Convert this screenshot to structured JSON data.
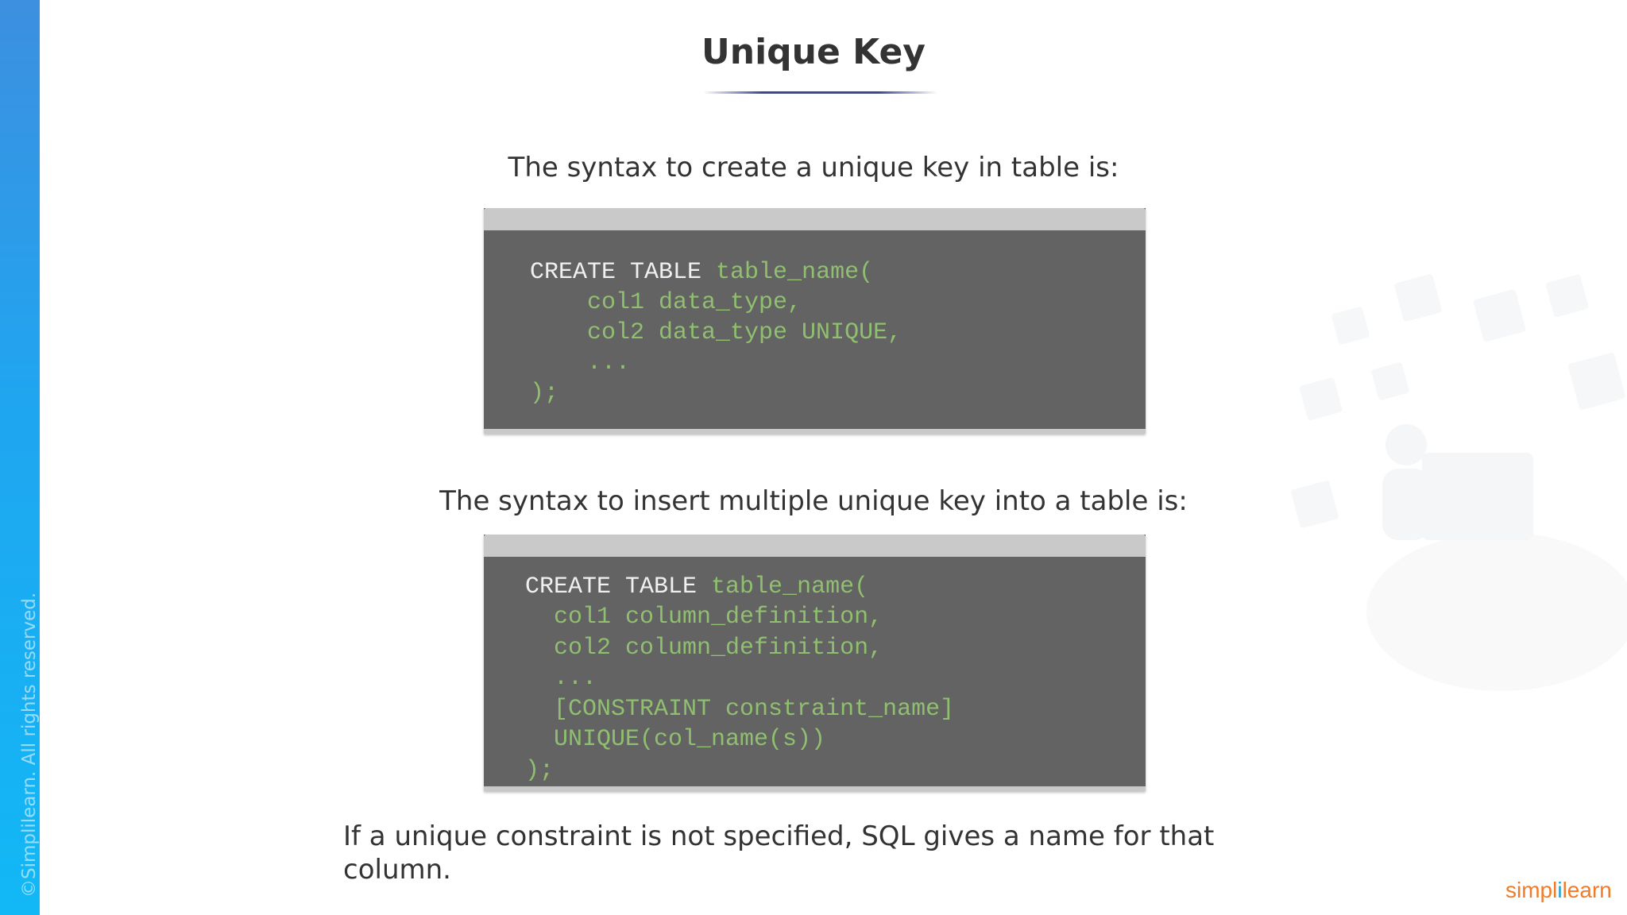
{
  "slide": {
    "title": "Unique Key",
    "copyright": "©Simplilearn. All rights reserved.",
    "caption1": "The syntax to create a unique key in table is:",
    "code1": {
      "line1_kw": "CREATE TABLE ",
      "line1_rest": "table_name(",
      "line2": "    col1 data_type,",
      "line3": "    col2 data_type UNIQUE,",
      "line4": "    ...",
      "line5": ");"
    },
    "caption2": "The syntax to insert multiple unique key into a table is:",
    "code2": {
      "line1_kw": "CREATE TABLE ",
      "line1_rest": "table_name(",
      "line2": "  col1 column_definition,",
      "line3": "  col2 column_definition,",
      "line4": "  ...",
      "line5": "  [CONSTRAINT constraint_name]",
      "line6": "  UNIQUE(col_name(s))",
      "line7": ");"
    },
    "note": "If a unique constraint is not specified, SQL gives a name for that column.",
    "logo_part1": "simpl",
    "logo_part2": "i",
    "logo_part3": "learn"
  },
  "colors": {
    "sidebar": "#1fa6f0",
    "code_background": "#636363",
    "code_keyword": "#f0f0f0",
    "code_text": "#8fbf6f",
    "title_rule": "#3c4896",
    "logo_orange": "#f07b2a",
    "logo_blue": "#1aa0e0"
  }
}
